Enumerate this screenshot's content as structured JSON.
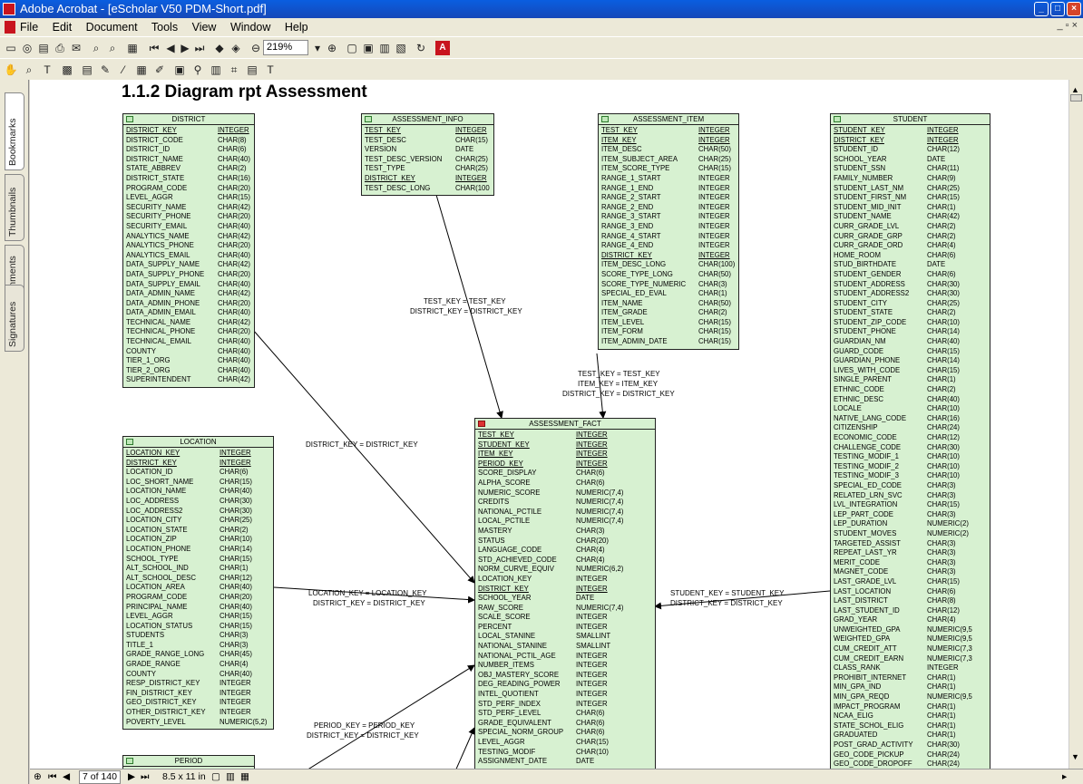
{
  "window": {
    "title": "Adobe Acrobat - [eScholar V50 PDM-Short.pdf]"
  },
  "menu": [
    "File",
    "Edit",
    "Document",
    "Tools",
    "View",
    "Window",
    "Help"
  ],
  "toolbar": {
    "zoom": "219%"
  },
  "sidebar_tabs": [
    "Bookmarks",
    "Thumbnails",
    "Comments",
    "Signatures"
  ],
  "page_title": "1.1.2 Diagram  rpt Assessment",
  "status": {
    "page": "7 of 140",
    "size": "8.5 x 11 in"
  },
  "tables": {
    "district": {
      "name": "DISTRICT",
      "rows": [
        [
          "DISTRICT_KEY",
          "INTEGER",
          true
        ],
        [
          "DISTRICT_CODE",
          "CHAR(8)",
          false
        ],
        [
          "DISTRICT_ID",
          "CHAR(6)",
          false
        ],
        [
          "DISTRICT_NAME",
          "CHAR(40)",
          false
        ],
        [
          "STATE_ABBREV",
          "CHAR(2)",
          false
        ],
        [
          "DISTRICT_STATE",
          "CHAR(16)",
          false
        ],
        [
          "PROGRAM_CODE",
          "CHAR(20)",
          false
        ],
        [
          "LEVEL_AGGR",
          "CHAR(15)",
          false
        ],
        [
          "SECURITY_NAME",
          "CHAR(42)",
          false
        ],
        [
          "SECURITY_PHONE",
          "CHAR(20)",
          false
        ],
        [
          "SECURITY_EMAIL",
          "CHAR(40)",
          false
        ],
        [
          "ANALYTICS_NAME",
          "CHAR(42)",
          false
        ],
        [
          "ANALYTICS_PHONE",
          "CHAR(20)",
          false
        ],
        [
          "ANALYTICS_EMAIL",
          "CHAR(40)",
          false
        ],
        [
          "DATA_SUPPLY_NAME",
          "CHAR(42)",
          false
        ],
        [
          "DATA_SUPPLY_PHONE",
          "CHAR(20)",
          false
        ],
        [
          "DATA_SUPPLY_EMAIL",
          "CHAR(40)",
          false
        ],
        [
          "DATA_ADMIN_NAME",
          "CHAR(42)",
          false
        ],
        [
          "DATA_ADMIN_PHONE",
          "CHAR(20)",
          false
        ],
        [
          "DATA_ADMIN_EMAIL",
          "CHAR(40)",
          false
        ],
        [
          "TECHNICAL_NAME",
          "CHAR(42)",
          false
        ],
        [
          "TECHNICAL_PHONE",
          "CHAR(20)",
          false
        ],
        [
          "TECHNICAL_EMAIL",
          "CHAR(40)",
          false
        ],
        [
          "COUNTY",
          "CHAR(40)",
          false
        ],
        [
          "TIER_1_ORG",
          "CHAR(40)",
          false
        ],
        [
          "TIER_2_ORG",
          "CHAR(40)",
          false
        ],
        [
          "SUPERINTENDENT",
          "CHAR(42)",
          false
        ]
      ]
    },
    "assessment_info": {
      "name": "ASSESSMENT_INFO",
      "rows": [
        [
          "TEST_KEY",
          "INTEGER",
          true
        ],
        [
          "TEST_DESC",
          "CHAR(15)",
          false
        ],
        [
          "VERSION",
          "DATE",
          false
        ],
        [
          "TEST_DESC_VERSION",
          "CHAR(25)",
          false
        ],
        [
          "TEST_TYPE",
          "CHAR(25)",
          false
        ],
        [
          "DISTRICT_KEY",
          "INTEGER",
          true
        ],
        [
          "TEST_DESC_LONG",
          "CHAR(100",
          false
        ]
      ]
    },
    "assessment_item": {
      "name": "ASSESSMENT_ITEM",
      "rows": [
        [
          "TEST_KEY",
          "INTEGER",
          true
        ],
        [
          "ITEM_KEY",
          "INTEGER",
          true
        ],
        [
          "ITEM_DESC",
          "CHAR(50)",
          false
        ],
        [
          "ITEM_SUBJECT_AREA",
          "CHAR(25)",
          false
        ],
        [
          "ITEM_SCORE_TYPE",
          "CHAR(15)",
          false
        ],
        [
          "RANGE_1_START",
          "INTEGER",
          false
        ],
        [
          "RANGE_1_END",
          "INTEGER",
          false
        ],
        [
          "RANGE_2_START",
          "INTEGER",
          false
        ],
        [
          "RANGE_2_END",
          "INTEGER",
          false
        ],
        [
          "RANGE_3_START",
          "INTEGER",
          false
        ],
        [
          "RANGE_3_END",
          "INTEGER",
          false
        ],
        [
          "RANGE_4_START",
          "INTEGER",
          false
        ],
        [
          "RANGE_4_END",
          "INTEGER",
          false
        ],
        [
          "DISTRICT_KEY",
          "INTEGER",
          true
        ],
        [
          "ITEM_DESC_LONG",
          "CHAR(100)",
          false
        ],
        [
          "SCORE_TYPE_LONG",
          "CHAR(50)",
          false
        ],
        [
          "SCORE_TYPE_NUMERIC",
          "CHAR(3)",
          false
        ],
        [
          "SPECIAL_ED_EVAL",
          "CHAR(1)",
          false
        ],
        [
          "ITEM_NAME",
          "CHAR(50)",
          false
        ],
        [
          "ITEM_GRADE",
          "CHAR(2)",
          false
        ],
        [
          "ITEM_LEVEL",
          "CHAR(15)",
          false
        ],
        [
          "ITEM_FORM",
          "CHAR(15)",
          false
        ],
        [
          "ITEM_ADMIN_DATE",
          "CHAR(15)",
          false
        ]
      ]
    },
    "student": {
      "name": "STUDENT",
      "rows": [
        [
          "STUDENT_KEY",
          "INTEGER",
          true
        ],
        [
          "DISTRICT_KEY",
          "INTEGER",
          true
        ],
        [
          "STUDENT_ID",
          "CHAR(12)",
          false
        ],
        [
          "SCHOOL_YEAR",
          "DATE",
          false
        ],
        [
          "STUDENT_SSN",
          "CHAR(11)",
          false
        ],
        [
          "FAMILY_NUMBER",
          "CHAR(9)",
          false
        ],
        [
          "STUDENT_LAST_NM",
          "CHAR(25)",
          false
        ],
        [
          "STUDENT_FIRST_NM",
          "CHAR(15)",
          false
        ],
        [
          "STUDENT_MID_INIT",
          "CHAR(1)",
          false
        ],
        [
          "STUDENT_NAME",
          "CHAR(42)",
          false
        ],
        [
          "CURR_GRADE_LVL",
          "CHAR(2)",
          false
        ],
        [
          "CURR_GRADE_GRP",
          "CHAR(2)",
          false
        ],
        [
          "CURR_GRADE_ORD",
          "CHAR(4)",
          false
        ],
        [
          "HOME_ROOM",
          "CHAR(6)",
          false
        ],
        [
          "STUD_BIRTHDATE",
          "DATE",
          false
        ],
        [
          "STUDENT_GENDER",
          "CHAR(6)",
          false
        ],
        [
          "STUDENT_ADDRESS",
          "CHAR(30)",
          false
        ],
        [
          "STUDENT_ADDRESS2",
          "CHAR(30)",
          false
        ],
        [
          "STUDENT_CITY",
          "CHAR(25)",
          false
        ],
        [
          "STUDENT_STATE",
          "CHAR(2)",
          false
        ],
        [
          "STUDENT_ZIP_CODE",
          "CHAR(10)",
          false
        ],
        [
          "STUDENT_PHONE",
          "CHAR(14)",
          false
        ],
        [
          "GUARDIAN_NM",
          "CHAR(40)",
          false
        ],
        [
          "GUARD_CODE",
          "CHAR(15)",
          false
        ],
        [
          "GUARDIAN_PHONE",
          "CHAR(14)",
          false
        ],
        [
          "LIVES_WITH_CODE",
          "CHAR(15)",
          false
        ],
        [
          "SINGLE_PARENT",
          "CHAR(1)",
          false
        ],
        [
          "ETHNIC_CODE",
          "CHAR(2)",
          false
        ],
        [
          "ETHNIC_DESC",
          "CHAR(40)",
          false
        ],
        [
          "LOCALE",
          "CHAR(10)",
          false
        ],
        [
          "NATIVE_LANG_CODE",
          "CHAR(16)",
          false
        ],
        [
          "CITIZENSHIP",
          "CHAR(24)",
          false
        ],
        [
          "ECONOMIC_CODE",
          "CHAR(12)",
          false
        ],
        [
          "CHALLENGE_CODE",
          "CHAR(30)",
          false
        ],
        [
          "TESTING_MODIF_1",
          "CHAR(10)",
          false
        ],
        [
          "TESTING_MODIF_2",
          "CHAR(10)",
          false
        ],
        [
          "TESTING_MODIF_3",
          "CHAR(10)",
          false
        ],
        [
          "SPECIAL_ED_CODE",
          "CHAR(3)",
          false
        ],
        [
          "RELATED_LRN_SVC",
          "CHAR(3)",
          false
        ],
        [
          "LVL_INTEGRATION",
          "CHAR(15)",
          false
        ],
        [
          "LEP_PART_CODE",
          "CHAR(3)",
          false
        ],
        [
          "LEP_DURATION",
          "NUMERIC(2)",
          false
        ],
        [
          "STUDENT_MOVES",
          "NUMERIC(2)",
          false
        ],
        [
          "TARGETED_ASSIST",
          "CHAR(3)",
          false
        ],
        [
          "REPEAT_LAST_YR",
          "CHAR(3)",
          false
        ],
        [
          "MERIT_CODE",
          "CHAR(3)",
          false
        ],
        [
          "MAGNET_CODE",
          "CHAR(3)",
          false
        ],
        [
          "LAST_GRADE_LVL",
          "CHAR(15)",
          false
        ],
        [
          "LAST_LOCATION",
          "CHAR(6)",
          false
        ],
        [
          "LAST_DISTRICT",
          "CHAR(8)",
          false
        ],
        [
          "LAST_STUDENT_ID",
          "CHAR(12)",
          false
        ],
        [
          "GRAD_YEAR",
          "CHAR(4)",
          false
        ],
        [
          "UNWEIGHTED_GPA",
          "NUMERIC(9,5",
          false
        ],
        [
          "WEIGHTED_GPA",
          "NUMERIC(9,5",
          false
        ],
        [
          "CUM_CREDIT_ATT",
          "NUMERIC(7,3",
          false
        ],
        [
          "CUM_CREDIT_EARN",
          "NUMERIC(7,3",
          false
        ],
        [
          "CLASS_RANK",
          "INTEGER",
          false
        ],
        [
          "PROHIBIT_INTERNET",
          "CHAR(1)",
          false
        ],
        [
          "MIN_GPA_IND",
          "CHAR(1)",
          false
        ],
        [
          "MIN_GPA_REQD",
          "NUMERIC(9,5",
          false
        ],
        [
          "IMPACT_PROGRAM",
          "CHAR(1)",
          false
        ],
        [
          "NCAA_ELIG",
          "CHAR(1)",
          false
        ],
        [
          "STATE_SCHOL_ELIG",
          "CHAR(1)",
          false
        ],
        [
          "GRADUATED",
          "CHAR(1)",
          false
        ],
        [
          "POST_GRAD_ACTIVITY",
          "CHAR(30)",
          false
        ],
        [
          "GEO_CODE_PICKUP",
          "CHAR(24)",
          false
        ],
        [
          "GEO_CODE_DROPOFF",
          "CHAR(24)",
          false
        ]
      ]
    },
    "location": {
      "name": "LOCATION",
      "rows": [
        [
          "LOCATION_KEY",
          "INTEGER",
          true
        ],
        [
          "DISTRICT_KEY",
          "INTEGER",
          true
        ],
        [
          "LOCATION_ID",
          "CHAR(6)",
          false
        ],
        [
          "LOC_SHORT_NAME",
          "CHAR(15)",
          false
        ],
        [
          "LOCATION_NAME",
          "CHAR(40)",
          false
        ],
        [
          "LOC_ADDRESS",
          "CHAR(30)",
          false
        ],
        [
          "LOC_ADDRESS2",
          "CHAR(30)",
          false
        ],
        [
          "LOCATION_CITY",
          "CHAR(25)",
          false
        ],
        [
          "LOCATION_STATE",
          "CHAR(2)",
          false
        ],
        [
          "LOCATION_ZIP",
          "CHAR(10)",
          false
        ],
        [
          "LOCATION_PHONE",
          "CHAR(14)",
          false
        ],
        [
          "SCHOOL_TYPE",
          "CHAR(15)",
          false
        ],
        [
          "ALT_SCHOOL_IND",
          "CHAR(1)",
          false
        ],
        [
          "ALT_SCHOOL_DESC",
          "CHAR(12)",
          false
        ],
        [
          "LOCATION_AREA",
          "CHAR(40)",
          false
        ],
        [
          "PROGRAM_CODE",
          "CHAR(20)",
          false
        ],
        [
          "PRINCIPAL_NAME",
          "CHAR(40)",
          false
        ],
        [
          "LEVEL_AGGR",
          "CHAR(15)",
          false
        ],
        [
          "LOCATION_STATUS",
          "CHAR(15)",
          false
        ],
        [
          "STUDENTS",
          "CHAR(3)",
          false
        ],
        [
          "TITLE_1",
          "CHAR(3)",
          false
        ],
        [
          "GRADE_RANGE_LONG",
          "CHAR(45)",
          false
        ],
        [
          "GRADE_RANGE",
          "CHAR(4)",
          false
        ],
        [
          "COUNTY",
          "CHAR(40)",
          false
        ],
        [
          "RESP_DISTRICT_KEY",
          "INTEGER",
          false
        ],
        [
          "FIN_DISTRICT_KEY",
          "INTEGER",
          false
        ],
        [
          "GEO_DISTRICT_KEY",
          "INTEGER",
          false
        ],
        [
          "OTHER_DISTRICT_KEY",
          "INTEGER",
          false
        ],
        [
          "POVERTY_LEVEL",
          "NUMERIC(5,2)",
          false
        ]
      ]
    },
    "assessment_fact": {
      "name": "ASSESSMENT_FACT",
      "rows": [
        [
          "TEST_KEY",
          "INTEGER",
          true
        ],
        [
          "STUDENT_KEY",
          "INTEGER",
          true
        ],
        [
          "ITEM_KEY",
          "INTEGER",
          true
        ],
        [
          "PERIOD_KEY",
          "INTEGER",
          true
        ],
        [
          "SCORE_DISPLAY",
          "CHAR(6)",
          false
        ],
        [
          "ALPHA_SCORE",
          "CHAR(6)",
          false
        ],
        [
          "NUMERIC_SCORE",
          "NUMERIC(7,4)",
          false
        ],
        [
          "CREDITS",
          "NUMERIC(7,4)",
          false
        ],
        [
          "NATIONAL_PCTILE",
          "NUMERIC(7,4)",
          false
        ],
        [
          "LOCAL_PCTILE",
          "NUMERIC(7,4)",
          false
        ],
        [
          "MASTERY",
          "CHAR(3)",
          false
        ],
        [
          "STATUS",
          "CHAR(20)",
          false
        ],
        [
          "LANGUAGE_CODE",
          "CHAR(4)",
          false
        ],
        [
          "STD_ACHIEVED_CODE",
          "CHAR(4)",
          false
        ],
        [
          "NORM_CURVE_EQUIV",
          "NUMERIC(6,2)",
          false
        ],
        [
          "LOCATION_KEY",
          "INTEGER",
          false
        ],
        [
          "DISTRICT_KEY",
          "INTEGER",
          true
        ],
        [
          "SCHOOL_YEAR",
          "DATE",
          false
        ],
        [
          "RAW_SCORE",
          "NUMERIC(7,4)",
          false
        ],
        [
          "SCALE_SCORE",
          "INTEGER",
          false
        ],
        [
          "PERCENT",
          "INTEGER",
          false
        ],
        [
          "LOCAL_STANINE",
          "SMALLINT",
          false
        ],
        [
          "NATIONAL_STANINE",
          "SMALLINT",
          false
        ],
        [
          "NATIONAL_PCTIL_AGE",
          "INTEGER",
          false
        ],
        [
          "NUMBER_ITEMS",
          "INTEGER",
          false
        ],
        [
          "OBJ_MASTERY_SCORE",
          "INTEGER",
          false
        ],
        [
          "DEG_READING_POWER",
          "INTEGER",
          false
        ],
        [
          "INTEL_QUOTIENT",
          "INTEGER",
          false
        ],
        [
          "STD_PERF_INDEX",
          "INTEGER",
          false
        ],
        [
          "STD_PERF_LEVEL",
          "CHAR(6)",
          false
        ],
        [
          "GRADE_EQUIVALENT",
          "CHAR(6)",
          false
        ],
        [
          "SPECIAL_NORM_GROUP",
          "CHAR(6)",
          false
        ],
        [
          "LEVEL_AGGR",
          "CHAR(15)",
          false
        ],
        [
          "TESTING_MODIF",
          "CHAR(10)",
          false
        ],
        [
          "ASSIGNMENT_DATE",
          "DATE",
          false
        ]
      ]
    },
    "period": {
      "name": "PERIOD",
      "rows": []
    }
  },
  "joins": {
    "info_fact": [
      "TEST_KEY = TEST_KEY",
      "DISTRICT_KEY = DISTRICT_KEY"
    ],
    "item_fact": [
      "TEST_KEY = TEST_KEY",
      "ITEM_KEY = ITEM_KEY",
      "DISTRICT_KEY = DISTRICT_KEY"
    ],
    "district_fact": [
      "DISTRICT_KEY = DISTRICT_KEY"
    ],
    "location_fact": [
      "LOCATION_KEY = LOCATION_KEY",
      "DISTRICT_KEY = DISTRICT_KEY"
    ],
    "student_fact": [
      "STUDENT_KEY = STUDENT_KEY",
      "DISTRICT_KEY = DISTRICT_KEY"
    ],
    "period_fact": [
      "PERIOD_KEY = PERIOD_KEY",
      "DISTRICT_KEY = DISTRICT_KEY"
    ]
  }
}
